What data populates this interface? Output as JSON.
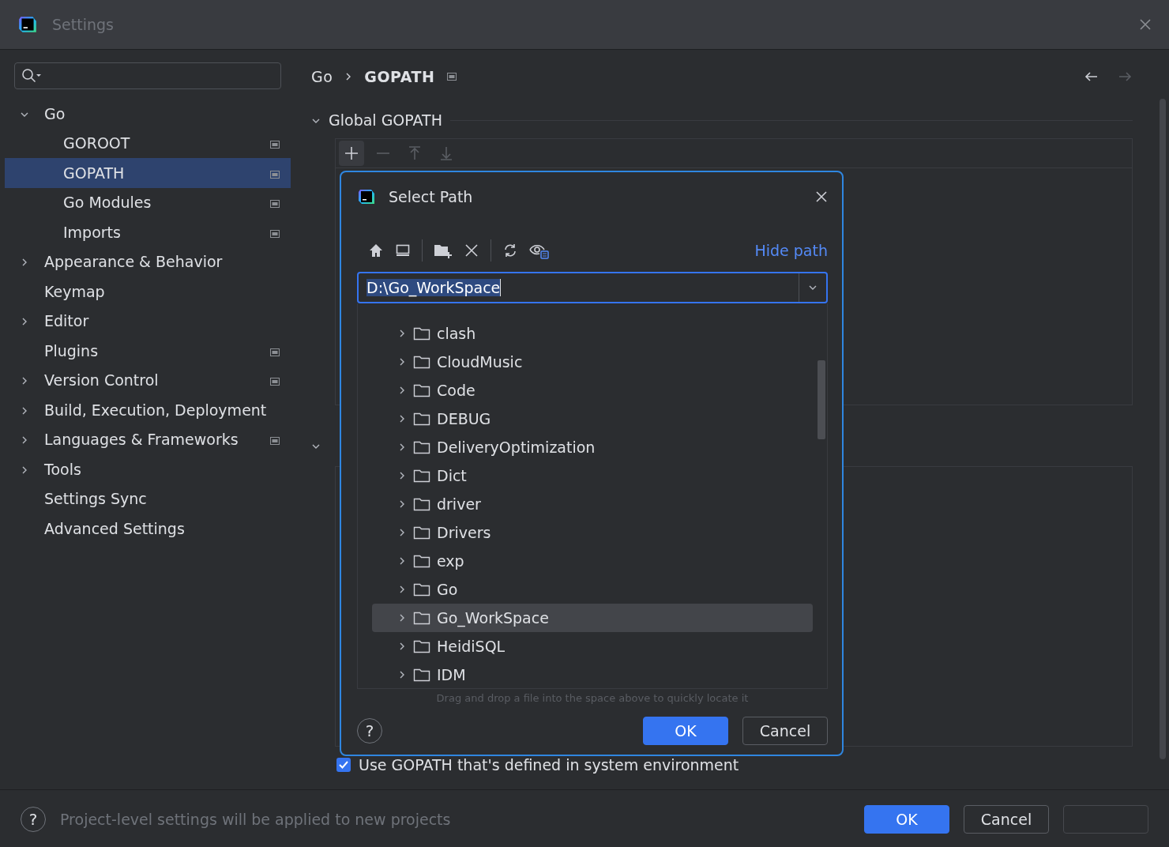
{
  "window": {
    "title": "Settings"
  },
  "sidebar": {
    "items": [
      {
        "label": "Go",
        "expanded": true,
        "selected": false,
        "project_scope": false,
        "children": [
          {
            "label": "GOROOT",
            "selected": false,
            "project_scope": true
          },
          {
            "label": "GOPATH",
            "selected": true,
            "project_scope": true
          },
          {
            "label": "Go Modules",
            "selected": false,
            "project_scope": true
          },
          {
            "label": "Imports",
            "selected": false,
            "project_scope": true
          }
        ]
      },
      {
        "label": "Appearance & Behavior",
        "expanded": false,
        "selected": false,
        "project_scope": false
      },
      {
        "label": "Keymap",
        "selected": false,
        "project_scope": false
      },
      {
        "label": "Editor",
        "expanded": false,
        "selected": false,
        "project_scope": false
      },
      {
        "label": "Plugins",
        "selected": false,
        "project_scope": true
      },
      {
        "label": "Version Control",
        "expanded": false,
        "selected": false,
        "project_scope": true
      },
      {
        "label": "Build, Execution, Deployment",
        "expanded": false,
        "selected": false,
        "project_scope": false
      },
      {
        "label": "Languages & Frameworks",
        "expanded": false,
        "selected": false,
        "project_scope": true
      },
      {
        "label": "Tools",
        "expanded": false,
        "selected": false,
        "project_scope": false
      },
      {
        "label": "Settings Sync",
        "selected": false,
        "project_scope": false
      },
      {
        "label": "Advanced Settings",
        "selected": false,
        "project_scope": false
      }
    ]
  },
  "breadcrumb": [
    "Go",
    "GOPATH"
  ],
  "section": {
    "title": "Global GOPATH",
    "expanded": true
  },
  "second_section": {
    "expanded": true
  },
  "system_gopath_checkbox": {
    "label": "Use GOPATH that's defined in system environment",
    "checked": true
  },
  "dialog": {
    "title": "Select Path",
    "hide_path_link": "Hide path",
    "path": "D:\\Go_WorkSpace",
    "tree": [
      {
        "name": "clash",
        "selected": false
      },
      {
        "name": "CloudMusic",
        "selected": false
      },
      {
        "name": "Code",
        "selected": false
      },
      {
        "name": "DEBUG",
        "selected": false
      },
      {
        "name": "DeliveryOptimization",
        "selected": false
      },
      {
        "name": "Dict",
        "selected": false
      },
      {
        "name": "driver",
        "selected": false
      },
      {
        "name": "Drivers",
        "selected": false
      },
      {
        "name": "exp",
        "selected": false
      },
      {
        "name": "Go",
        "selected": false
      },
      {
        "name": "Go_WorkSpace",
        "selected": true
      },
      {
        "name": "HeidiSQL",
        "selected": false
      },
      {
        "name": "IDM",
        "selected": false
      }
    ],
    "hint": "Drag and drop a file into the space above to quickly locate it",
    "help": "?",
    "buttons": [
      "OK",
      "Cancel"
    ]
  },
  "footer": {
    "help": "?",
    "note": "Project-level settings will be applied to new projects",
    "buttons": [
      "OK",
      "Cancel"
    ]
  }
}
